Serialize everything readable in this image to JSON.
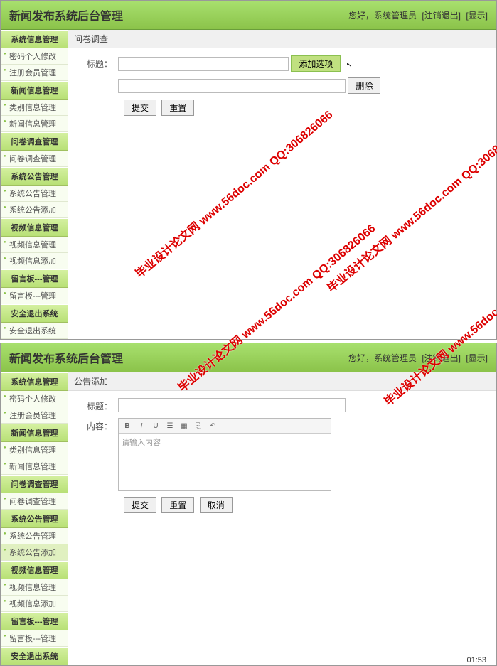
{
  "app_title": "新闻发布系统后台管理",
  "header_greeting": "您好，系统管理员",
  "header_logout": "[注销退出]",
  "header_show": "[显示]",
  "panel1": {
    "content_title": "问卷调查",
    "form_title_label": "标题：",
    "add_option_btn": "添加选项",
    "delete_btn": "删除",
    "submit_btn": "提交",
    "reset_btn": "重置",
    "sidebar": [
      {
        "type": "cat",
        "label": "系统信息管理"
      },
      {
        "type": "item",
        "label": "密码个人修改"
      },
      {
        "type": "item",
        "label": "注册会员管理"
      },
      {
        "type": "cat",
        "label": "新闻信息管理"
      },
      {
        "type": "item",
        "label": "类别信息管理"
      },
      {
        "type": "item",
        "label": "新闻信息管理"
      },
      {
        "type": "cat",
        "label": "问卷调查管理"
      },
      {
        "type": "item",
        "label": "问卷调查管理"
      },
      {
        "type": "cat",
        "label": "系统公告管理"
      },
      {
        "type": "item",
        "label": "系统公告管理"
      },
      {
        "type": "item",
        "label": "系统公告添加"
      },
      {
        "type": "cat",
        "label": "视频信息管理"
      },
      {
        "type": "item",
        "label": "视频信息管理"
      },
      {
        "type": "item",
        "label": "视频信息添加"
      },
      {
        "type": "cat",
        "label": "留言板---管理"
      },
      {
        "type": "item",
        "label": "留言板---管理"
      },
      {
        "type": "cat",
        "label": "安全退出系统"
      },
      {
        "type": "item",
        "label": "安全退出系统"
      }
    ]
  },
  "panel2": {
    "content_title": "公告添加",
    "form_title_label": "标题：",
    "form_content_label": "内容：",
    "editor_placeholder": "请输入内容",
    "submit_btn": "提交",
    "reset_btn": "重置",
    "cancel_btn": "取消",
    "sidebar": [
      {
        "type": "cat",
        "label": "系统信息管理"
      },
      {
        "type": "item",
        "label": "密码个人修改"
      },
      {
        "type": "item",
        "label": "注册会员管理"
      },
      {
        "type": "cat",
        "label": "新闻信息管理"
      },
      {
        "type": "item",
        "label": "类别信息管理"
      },
      {
        "type": "item",
        "label": "新闻信息管理"
      },
      {
        "type": "cat",
        "label": "问卷调查管理"
      },
      {
        "type": "item",
        "label": "问卷调查管理"
      },
      {
        "type": "cat",
        "label": "系统公告管理"
      },
      {
        "type": "item",
        "label": "系统公告管理"
      },
      {
        "type": "item",
        "label": "系统公告添加",
        "active": true
      },
      {
        "type": "cat",
        "label": "视频信息管理"
      },
      {
        "type": "item",
        "label": "视频信息管理"
      },
      {
        "type": "item",
        "label": "视频信息添加"
      },
      {
        "type": "cat",
        "label": "留言板---管理"
      },
      {
        "type": "item",
        "label": "留言板---管理"
      },
      {
        "type": "cat",
        "label": "安全退出系统"
      }
    ]
  },
  "watermark_text": "毕业设计论文网  www.56doc.com  QQ:306826066",
  "timestamp": "01:53"
}
